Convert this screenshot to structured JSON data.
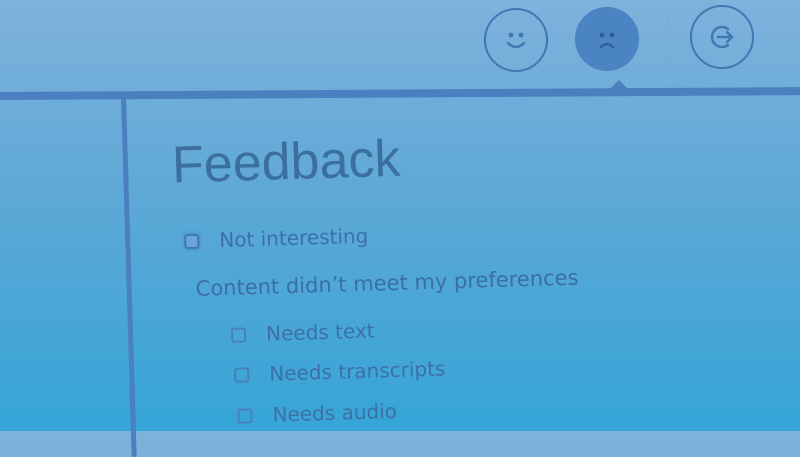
{
  "toolbar": {
    "buttons": [
      {
        "name": "happy",
        "icon": "smiley-face-icon"
      },
      {
        "name": "sad",
        "icon": "frowning-face-icon",
        "selected": true
      },
      {
        "name": "exit",
        "icon": "exit-arrow-icon"
      }
    ]
  },
  "feedback": {
    "title": "Feedback",
    "not_interesting_label": "Not interesting",
    "preferences_heading": "Content didn’t meet my preferences",
    "options": [
      {
        "label": "Needs text"
      },
      {
        "label": "Needs transcripts"
      },
      {
        "label": "Needs audio"
      }
    ]
  },
  "colors": {
    "background_top": "#7fb2dc",
    "background_bottom": "#35a5d7",
    "accent": "#4a80bf",
    "text": "#3d70a6"
  }
}
